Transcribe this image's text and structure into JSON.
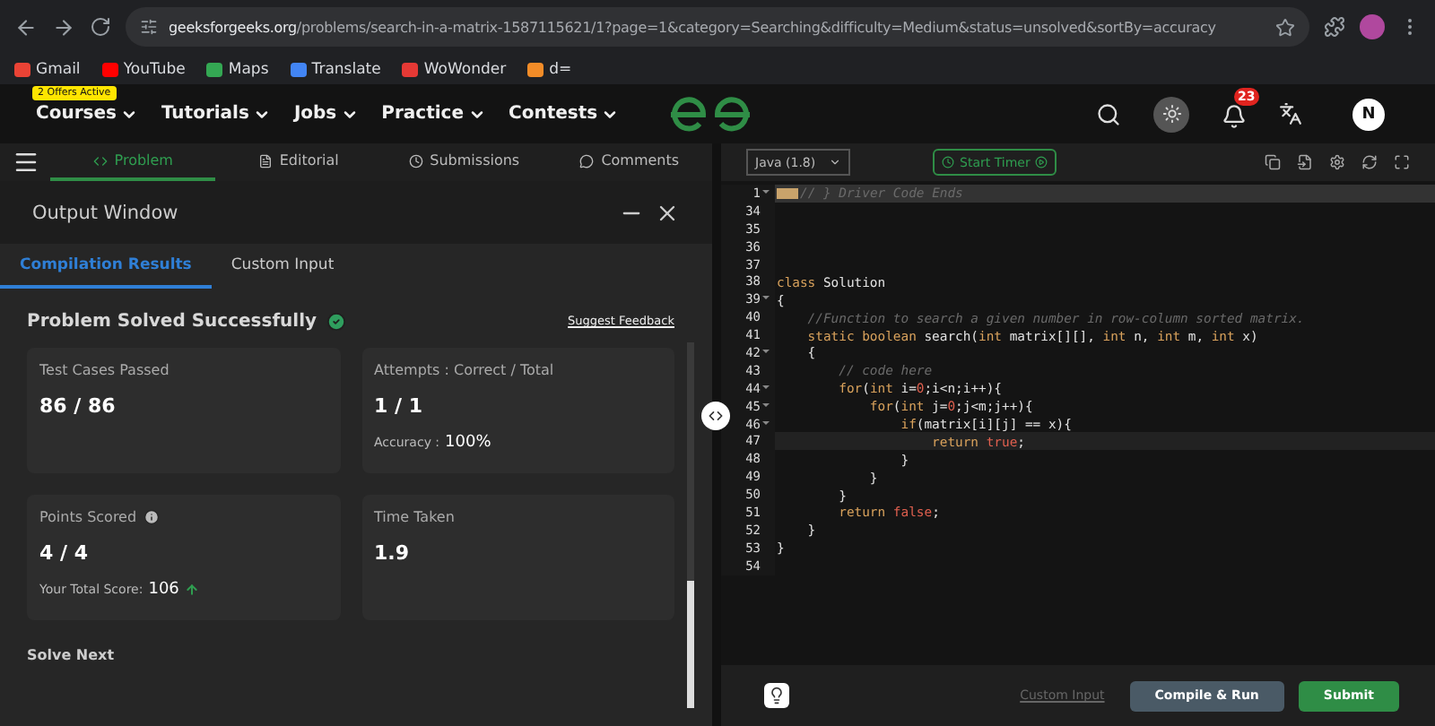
{
  "browser": {
    "url": "**geeksforgeeks.org**/problems/search-in-a-matrix-1587115621/1?page=1&category=Searching&difficulty=Medium&status=unsolved&sortBy=accuracy",
    "bookmarks": [
      {
        "label": "Gmail",
        "color": "#ea4335"
      },
      {
        "label": "YouTube",
        "color": "#ff0000"
      },
      {
        "label": "Maps",
        "color": "#34a853"
      },
      {
        "label": "Translate",
        "color": "#4285f4"
      },
      {
        "label": "WoWonder",
        "color": "#e53935"
      },
      {
        "label": "d=",
        "color": "#f28c28"
      }
    ]
  },
  "nav": {
    "badge": "2 Offers Active",
    "items": [
      "Courses",
      "Tutorials",
      "Jobs",
      "Practice",
      "Contests"
    ],
    "notifications": "23",
    "avatar": "N"
  },
  "tabs": [
    {
      "label": "Problem",
      "selected": true
    },
    {
      "label": "Editorial",
      "selected": false
    },
    {
      "label": "Submissions",
      "selected": false
    },
    {
      "label": "Comments",
      "selected": false
    }
  ],
  "output": {
    "title": "Output Window",
    "tabs": [
      {
        "label": "Compilation Results",
        "selected": true
      },
      {
        "label": "Custom Input",
        "selected": false
      }
    ],
    "heading": "Problem Solved Successfully",
    "feedback": "Suggest Feedback",
    "cards": [
      {
        "label": "Test Cases Passed",
        "value": "86 / 86"
      },
      {
        "label": "Attempts : Correct / Total",
        "value": "1 / 1",
        "note_label": "Accuracy :",
        "note_value": "100%"
      },
      {
        "label": "Points Scored",
        "info": true,
        "value": "4 / 4",
        "note_label": "Your Total Score:",
        "note_value": "106",
        "rising": true
      },
      {
        "label": "Time Taken",
        "value": "1.9"
      }
    ],
    "solve_next": "Solve Next"
  },
  "editor": {
    "language": "Java (1.8)",
    "timer": "Start Timer",
    "lines": [
      {
        "number": "1",
        "foldable": true,
        "folded": true,
        "active": false,
        "tokens": [
          {
            "kind": "comment",
            "text": "// } Driver Code Ends"
          }
        ]
      },
      {
        "number": "34",
        "foldable": false,
        "active": false
      },
      {
        "number": "35",
        "foldable": false,
        "active": false
      },
      {
        "number": "36",
        "foldable": false,
        "active": false
      },
      {
        "number": "37",
        "foldable": false,
        "active": false
      },
      {
        "number": "38",
        "foldable": false,
        "active": false,
        "tokens": [
          {
            "kind": "keyword",
            "text": "class"
          },
          {
            "kind": "plain",
            "text": " Solution"
          }
        ]
      },
      {
        "number": "39",
        "foldable": true,
        "active": false,
        "tokens": [
          {
            "kind": "plain",
            "text": "{"
          }
        ]
      },
      {
        "number": "40",
        "foldable": false,
        "active": false,
        "tokens": [
          {
            "kind": "comment",
            "text": "    //Function to search a given number in row-column sorted matrix."
          }
        ]
      },
      {
        "number": "41",
        "foldable": false,
        "active": false,
        "tokens": [
          {
            "kind": "keyword",
            "text": "    static boolean"
          },
          {
            "kind": "plain",
            "text": " search("
          },
          {
            "kind": "keyword",
            "text": "int"
          },
          {
            "kind": "plain",
            "text": " matrix[][], "
          },
          {
            "kind": "keyword",
            "text": "int"
          },
          {
            "kind": "plain",
            "text": " n, "
          },
          {
            "kind": "keyword",
            "text": "int"
          },
          {
            "kind": "plain",
            "text": " m, "
          },
          {
            "kind": "keyword",
            "text": "int"
          },
          {
            "kind": "plain",
            "text": " x)"
          }
        ]
      },
      {
        "number": "42",
        "foldable": true,
        "active": false,
        "tokens": [
          {
            "kind": "plain",
            "text": "    {"
          }
        ]
      },
      {
        "number": "43",
        "foldable": false,
        "active": false,
        "tokens": [
          {
            "kind": "comment",
            "text": "        // code here"
          }
        ]
      },
      {
        "number": "44",
        "foldable": true,
        "active": false,
        "tokens": [
          {
            "kind": "keyword",
            "text": "        for"
          },
          {
            "kind": "plain",
            "text": "("
          },
          {
            "kind": "keyword",
            "text": "int"
          },
          {
            "kind": "plain",
            "text": " i="
          },
          {
            "kind": "literal",
            "text": "0"
          },
          {
            "kind": "plain",
            "text": ";i<n;i++){"
          }
        ]
      },
      {
        "number": "45",
        "foldable": true,
        "active": false,
        "tokens": [
          {
            "kind": "keyword",
            "text": "            for"
          },
          {
            "kind": "plain",
            "text": "("
          },
          {
            "kind": "keyword",
            "text": "int"
          },
          {
            "kind": "plain",
            "text": " j="
          },
          {
            "kind": "literal",
            "text": "0"
          },
          {
            "kind": "plain",
            "text": ";j<m;j++){"
          }
        ]
      },
      {
        "number": "46",
        "foldable": true,
        "active": false,
        "tokens": [
          {
            "kind": "keyword",
            "text": "                if"
          },
          {
            "kind": "plain",
            "text": "(matrix[i][j] == x){"
          }
        ]
      },
      {
        "number": "47",
        "foldable": false,
        "active": true,
        "tokens": [
          {
            "kind": "keyword",
            "text": "                    return"
          },
          {
            "kind": "literal",
            "text": " true"
          },
          {
            "kind": "plain",
            "text": ";"
          }
        ]
      },
      {
        "number": "48",
        "foldable": false,
        "active": false,
        "tokens": [
          {
            "kind": "plain",
            "text": "                }"
          }
        ]
      },
      {
        "number": "49",
        "foldable": false,
        "active": false,
        "tokens": [
          {
            "kind": "plain",
            "text": "            }"
          }
        ]
      },
      {
        "number": "50",
        "foldable": false,
        "active": false,
        "tokens": [
          {
            "kind": "plain",
            "text": "        }"
          }
        ]
      },
      {
        "number": "51",
        "foldable": false,
        "active": false,
        "tokens": [
          {
            "kind": "keyword",
            "text": "        return"
          },
          {
            "kind": "literal",
            "text": " false"
          },
          {
            "kind": "plain",
            "text": ";"
          }
        ]
      },
      {
        "number": "52",
        "foldable": false,
        "active": false,
        "tokens": [
          {
            "kind": "plain",
            "text": "    }"
          }
        ]
      },
      {
        "number": "53",
        "foldable": false,
        "active": false,
        "tokens": [
          {
            "kind": "plain",
            "text": "}"
          }
        ]
      },
      {
        "number": "54",
        "foldable": false,
        "active": false
      }
    ],
    "custom_input": {
      "label": "Custom Input",
      "disabled": true
    },
    "compile": "Compile & Run",
    "submit": "Submit"
  }
}
